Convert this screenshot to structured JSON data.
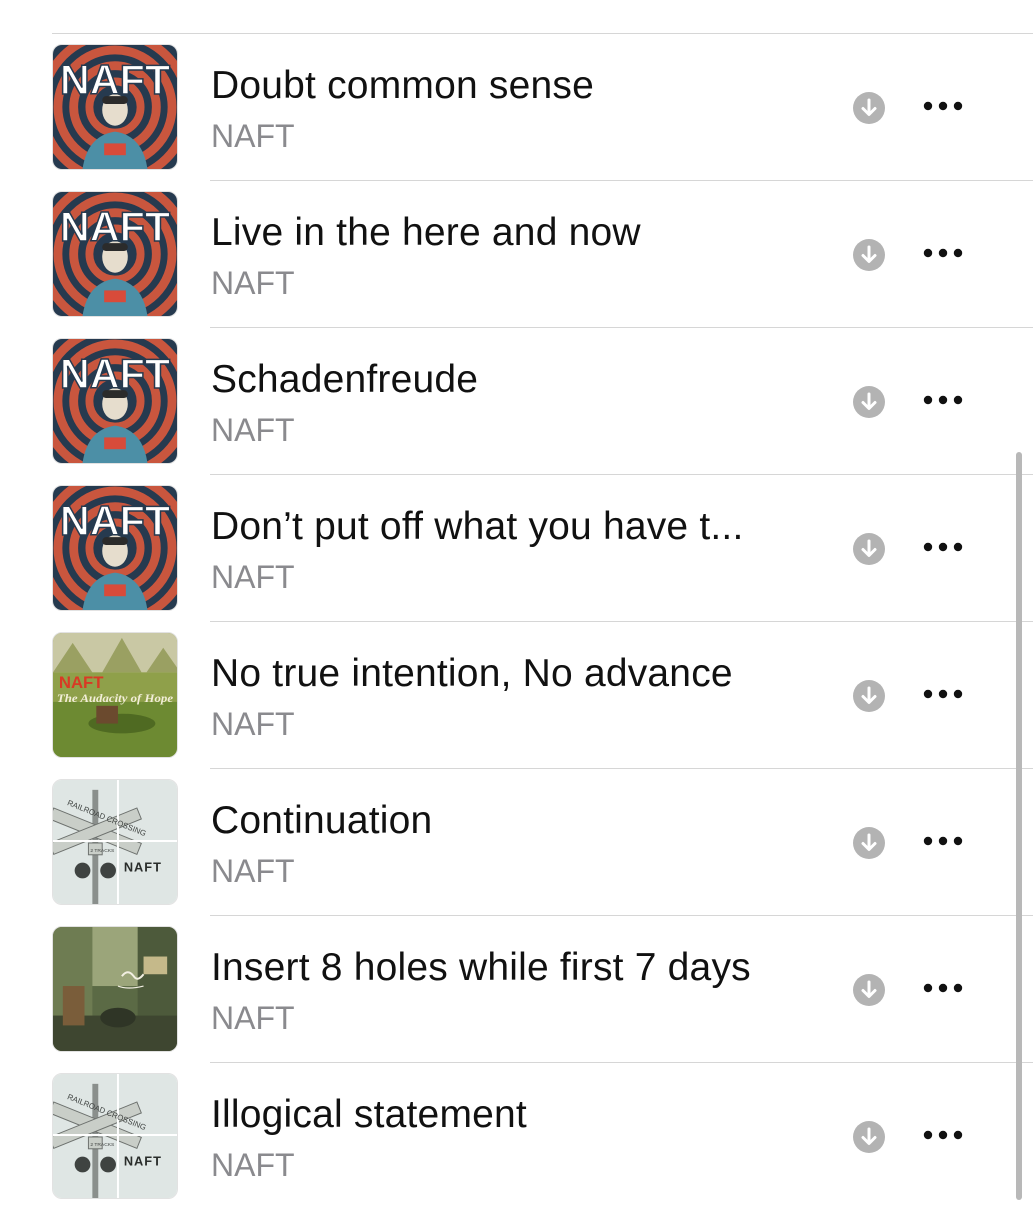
{
  "tracks": [
    {
      "title": "Doubt common sense",
      "artist": "NAFT",
      "artwork": "spiral-cover"
    },
    {
      "title": "Live in the here and now",
      "artist": "NAFT",
      "artwork": "spiral-cover"
    },
    {
      "title": "Schadenfreude",
      "artist": "NAFT",
      "artwork": "spiral-cover"
    },
    {
      "title": "Don’t put off what you have t...",
      "artist": "NAFT",
      "artwork": "spiral-cover"
    },
    {
      "title": "No true intention, No advance",
      "artist": "NAFT",
      "artwork": "audacity-cover",
      "artwork_text": [
        "NAFT",
        "The Audacity of Hope"
      ]
    },
    {
      "title": "Continuation",
      "artist": "NAFT",
      "artwork": "crossing-cover",
      "artwork_text": [
        "RAILROAD CROSSING",
        "2 TRACKS",
        "NAFT"
      ]
    },
    {
      "title": "Insert 8 holes while first 7 days",
      "artist": "NAFT",
      "artwork": "street-cover"
    },
    {
      "title": "Illogical statement",
      "artist": "NAFT",
      "artwork": "crossing-cover",
      "artwork_text": [
        "RAILROAD CROSSING",
        "2 TRACKS",
        "NAFT"
      ]
    }
  ],
  "icons": {
    "download": "download-icon",
    "more": "more-icon"
  },
  "colors": {
    "text_primary": "#111111",
    "text_secondary": "#8a8a8e",
    "icon_gray": "#b3b3b3",
    "divider": "#d6d6d6"
  }
}
